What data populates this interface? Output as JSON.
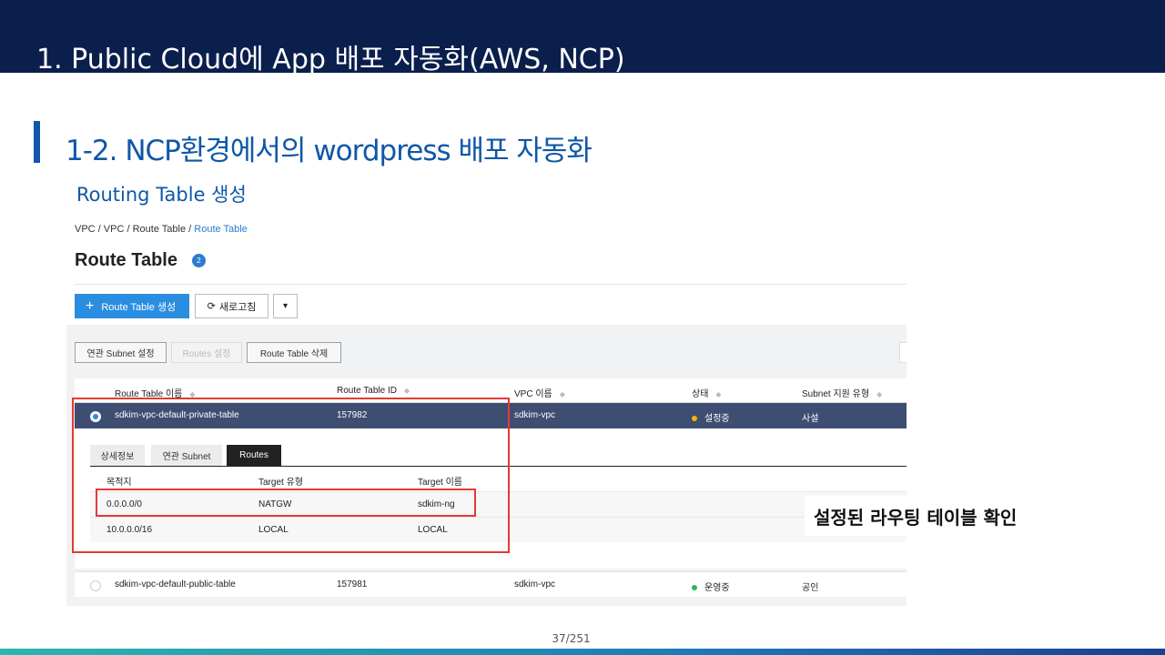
{
  "slide": {
    "title": "1. Public Cloud에 App 배포 자동화(AWS, NCP)",
    "section_title": "1-2. NCP환경에서의 wordpress 배포 자동화",
    "sub_title": "Routing Table 생성",
    "callout": "설정된 라우팅 테이블 확인",
    "page_number": "37/251"
  },
  "console": {
    "breadcrumb": [
      "VPC",
      "VPC",
      "Route Table",
      "Route Table"
    ],
    "page_title": "Route Table",
    "count": "2",
    "buttons": {
      "create": "Route Table 생성",
      "refresh": "새로고침"
    },
    "actions": {
      "subnet": "연관 Subnet 설정",
      "routes": "Routes 설정",
      "delete": "Route Table 삭제"
    },
    "columns": [
      "Route Table 이름",
      "Route Table ID",
      "VPC 이름",
      "상태",
      "Subnet 지원 유형"
    ],
    "rows": [
      {
        "name": "sdkim-vpc-default-private-table",
        "id": "157982",
        "vpc": "sdkim-vpc",
        "status": "설정중",
        "status_color": "#f5b400",
        "type": "사설",
        "selected": true
      },
      {
        "name": "sdkim-vpc-default-public-table",
        "id": "157981",
        "vpc": "sdkim-vpc",
        "status": "운영중",
        "status_color": "#2db84d",
        "type": "공인",
        "selected": false
      }
    ],
    "detail_tabs": [
      "상세정보",
      "연관 Subnet",
      "Routes"
    ],
    "active_tab": "Routes",
    "routes_columns": [
      "목적지",
      "Target 유형",
      "Target 이름"
    ],
    "routes": [
      {
        "dest": "0.0.0.0/0",
        "type": "NATGW",
        "target": "sdkim-ng"
      },
      {
        "dest": "10.0.0.0/16",
        "type": "LOCAL",
        "target": "LOCAL"
      }
    ]
  },
  "colors": {
    "header_bg": "#0b1f4d",
    "accent": "#0f57a8",
    "button_primary": "#2a8de0",
    "selected_row": "#3e4d72",
    "highlight_box": "#e53935"
  }
}
